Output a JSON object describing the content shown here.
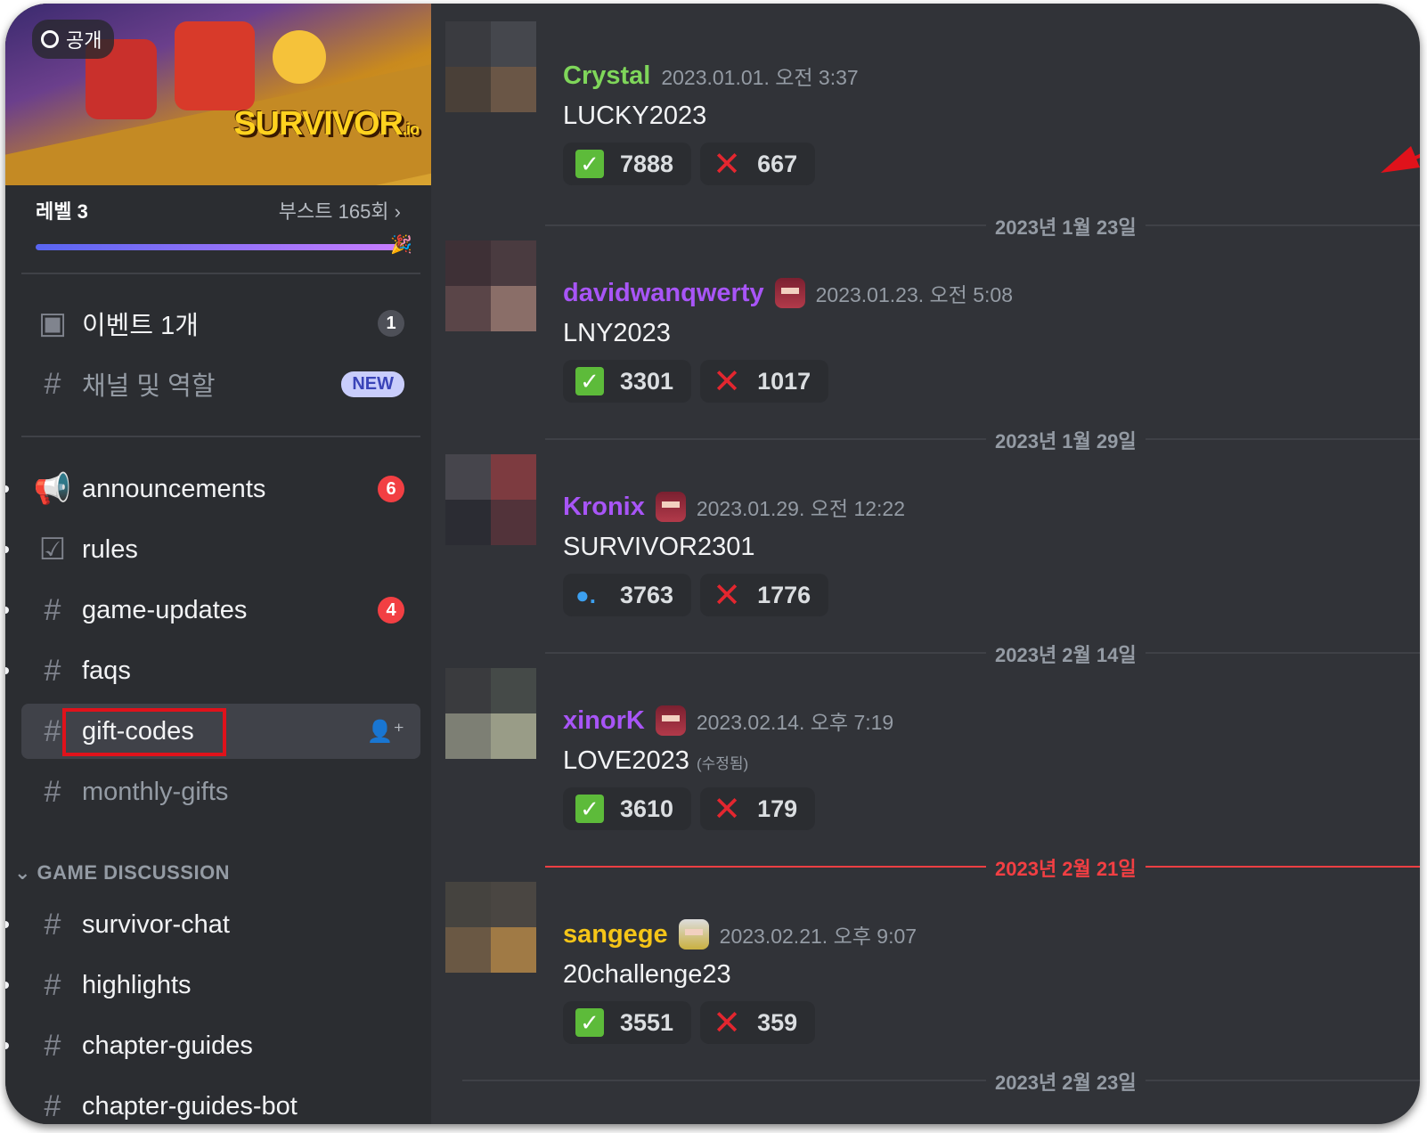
{
  "server": {
    "banner_logo": "SURVIVOR.io",
    "visibility": "공개",
    "level": "레벨 3",
    "boost": "부스트 165회",
    "boost_progress": 1.0
  },
  "sidebar": {
    "top_items": [
      {
        "icon": "calendar-icon",
        "label": "이벤트 1개",
        "badge": "1"
      },
      {
        "icon": "channel-browse-icon",
        "label": "채널 및 역할",
        "badge": "NEW"
      }
    ],
    "channels": [
      {
        "icon": "megaphone-icon",
        "label": "announcements",
        "badge": "6",
        "unread": true
      },
      {
        "icon": "checkbox-icon",
        "label": "rules",
        "unread": true
      },
      {
        "icon": "hash-icon",
        "label": "game-updates",
        "badge": "4",
        "unread": true
      },
      {
        "icon": "hash-icon",
        "label": "faqs",
        "unread": true
      },
      {
        "icon": "hash-icon",
        "label": "gift-codes",
        "selected": true
      },
      {
        "icon": "hash-icon",
        "label": "monthly-gifts",
        "muted": true
      }
    ],
    "category": "GAME DISCUSSION",
    "category_channels": [
      {
        "icon": "hash-icon",
        "label": "survivor-chat"
      },
      {
        "icon": "hash-icon",
        "label": "highlights"
      },
      {
        "icon": "hash-icon",
        "label": "chapter-guides"
      },
      {
        "icon": "hash-lock-icon",
        "label": "chapter-guides-bot"
      }
    ]
  },
  "messages": [
    {
      "user": "Crystal",
      "color": "#7fd65a",
      "time": "2023.01.01. 오전 3:37",
      "text": "LUCKY2023",
      "edited": "",
      "react1": {
        "icon": "check-icon",
        "count": "7888"
      },
      "react2": {
        "icon": "x-icon",
        "count": "667"
      },
      "avatar": [
        "#3a3b40",
        "#45474d",
        "#4a4038",
        "#6a5646"
      ]
    },
    {
      "user": "davidwanqwerty",
      "color": "#a855f7",
      "time": "2023.01.23. 오전 5:08",
      "text": "LNY2023",
      "edited": "",
      "react1": {
        "icon": "check-icon",
        "count": "3301"
      },
      "react2": {
        "icon": "x-icon",
        "count": "1017"
      },
      "avatar": [
        "#3e3036",
        "#4a3b40",
        "#5a4548",
        "#8a6e68"
      ]
    },
    {
      "user": "Kronix",
      "color": "#a855f7",
      "time": "2023.01.29. 오전 12:22",
      "text": "SURVIVOR2301",
      "edited": "",
      "react1": {
        "icon": "blue-emoji-icon",
        "count": "3763"
      },
      "react2": {
        "icon": "x-icon",
        "count": "1776"
      },
      "avatar": [
        "#46454c",
        "#7d3b40",
        "#2b2c33",
        "#52333a"
      ]
    },
    {
      "user": "xinorK",
      "color": "#a855f7",
      "time": "2023.02.14. 오후 7:19",
      "text": "LOVE2023",
      "edited": "(수정됨)",
      "react1": {
        "icon": "check-icon",
        "count": "3610"
      },
      "react2": {
        "icon": "x-icon",
        "count": "179"
      },
      "avatar": [
        "#3a3b3e",
        "#454a48",
        "#7d7f74",
        "#999c87"
      ]
    },
    {
      "user": "sangege",
      "color": "#f5c518",
      "time": "2023.02.21. 오후 9:07",
      "text": "20challenge23",
      "edited": "",
      "react1": {
        "icon": "check-icon",
        "count": "3551"
      },
      "react2": {
        "icon": "x-icon",
        "count": "359"
      },
      "avatar": [
        "#45433f",
        "#4a4642",
        "#6a5844",
        "#a07a45"
      ]
    }
  ],
  "separators": [
    "2023년 1월 23일",
    "2023년 1월 29일",
    "2023년 2월 14일",
    "2023년 2월 21일",
    "2023년 2월 23일"
  ],
  "new_separator_color": "#f23f43"
}
